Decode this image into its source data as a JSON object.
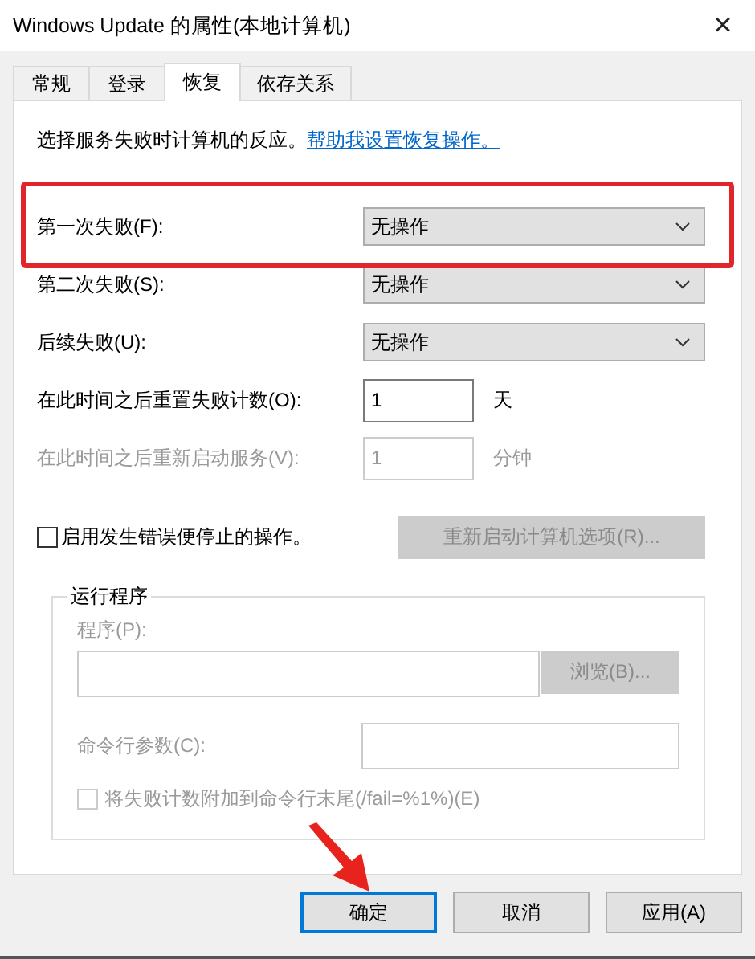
{
  "window": {
    "title": "Windows Update 的属性(本地计算机)",
    "close": "×"
  },
  "tabs": [
    {
      "label": "常规",
      "selected": false
    },
    {
      "label": "登录",
      "selected": false
    },
    {
      "label": "恢复",
      "selected": true
    },
    {
      "label": "依存关系",
      "selected": false
    }
  ],
  "intro": {
    "text": "选择服务失败时计算机的反应。",
    "link": "帮助我设置恢复操作。"
  },
  "failure_actions": [
    {
      "label": "第一次失败(F):",
      "value": "无操作"
    },
    {
      "label": "第二次失败(S):",
      "value": "无操作"
    },
    {
      "label": "后续失败(U):",
      "value": "无操作"
    }
  ],
  "counters": [
    {
      "label": "在此时间之后重置失败计数(O):",
      "value": "1",
      "unit": "天",
      "disabled": false
    },
    {
      "label": "在此时间之后重新启动服务(V):",
      "value": "1",
      "unit": "分钟",
      "disabled": true
    }
  ],
  "stop_on_error": {
    "label": "启用发生错误便停止的操作。",
    "checked": false
  },
  "restart_computer_button": {
    "label": "重新启动计算机选项(R)...",
    "disabled": true
  },
  "run_program": {
    "title": "运行程序",
    "program_label": "程序(P):",
    "browse_button": "浏览(B)...",
    "params_label": "命令行参数(C):",
    "append": {
      "label": "将失败计数附加到命令行末尾(/fail=%1%)(E)",
      "checked": false
    },
    "disabled": true
  },
  "buttons": [
    {
      "label": "确定",
      "selected": true
    },
    {
      "label": "取消",
      "selected": false
    },
    {
      "label": "应用(A)",
      "selected": false
    }
  ],
  "annotations": {
    "highlight_frame": true,
    "arrow": true
  }
}
